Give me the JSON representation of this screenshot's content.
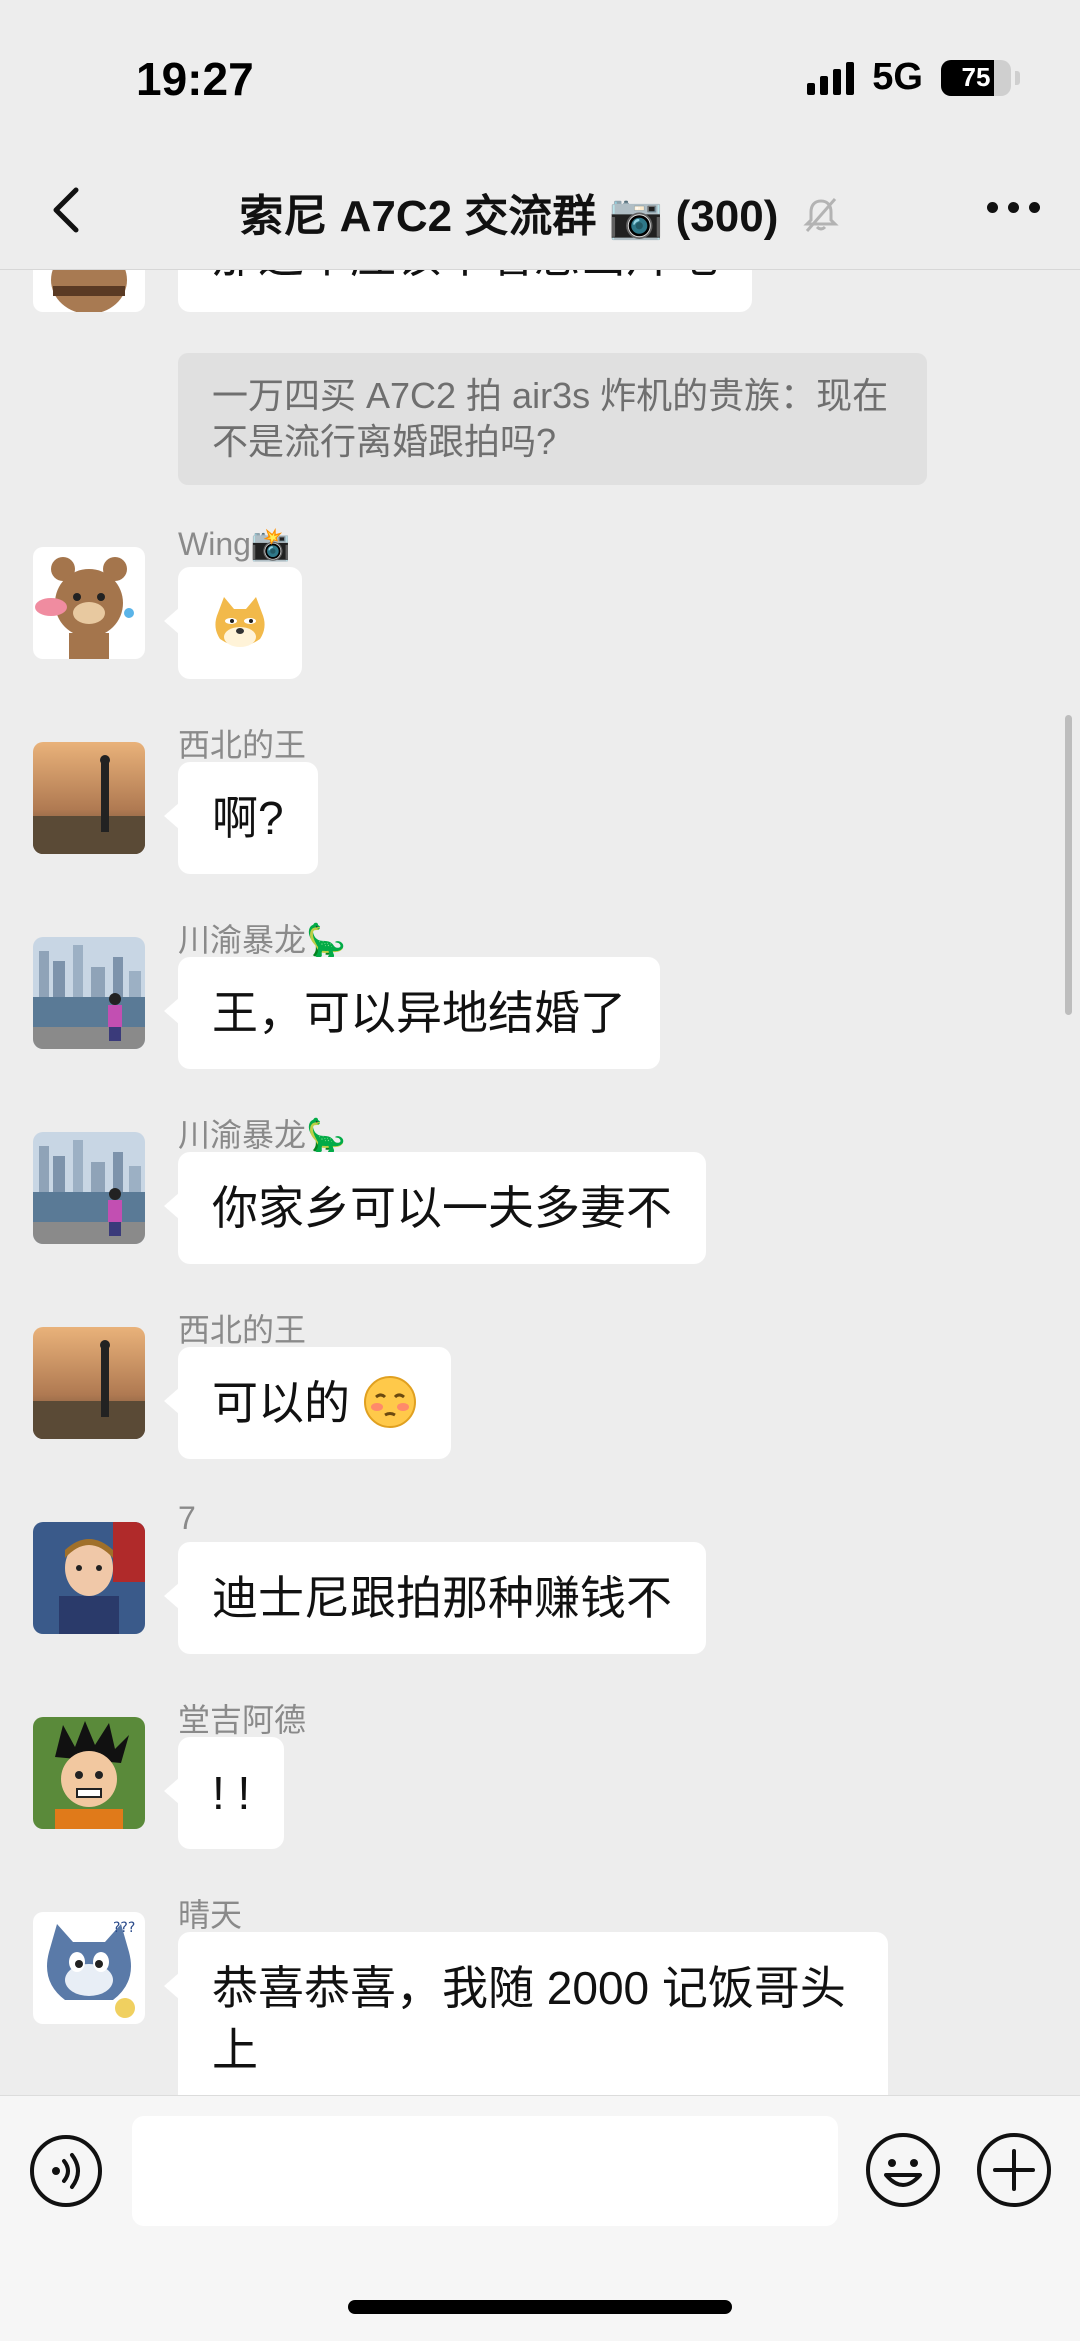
{
  "status": {
    "time": "19:27",
    "network": "5G",
    "battery": "75",
    "battery_level": 0.75
  },
  "nav": {
    "title": "索尼 A7C2 交流群",
    "title_emoji": "📷",
    "member_count": "(300)"
  },
  "messages": [
    {
      "type": "partial",
      "text": "那这个应该不着急出片吧"
    },
    {
      "type": "quote",
      "text": "一万四买 A7C2 拍 air3s 炸机的贵族：现在不是流行离婚跟拍吗?"
    },
    {
      "sender": "Wing📸",
      "text": "",
      "sticker": "doge-sticker"
    },
    {
      "sender": "西北的王",
      "text": "啊?"
    },
    {
      "sender": "川渝暴龙🦕",
      "text": "王，可以异地结婚了"
    },
    {
      "sender": "川渝暴龙🦕",
      "text": "你家乡可以一夫多妻不"
    },
    {
      "sender": "西北的王",
      "text": "可以的"
    },
    {
      "sender": "7",
      "text": "迪士尼跟拍那种赚钱不"
    },
    {
      "sender": "堂吉阿德",
      "text": "! !"
    },
    {
      "sender": "晴天",
      "text": "恭喜恭喜，我随 2000 记饭哥头",
      "text2": "上"
    }
  ],
  "colors": {
    "bg": "#ededed",
    "bubble": "#ffffff",
    "sender": "#8a8a8a",
    "quote_bg": "#e0e0e0"
  }
}
